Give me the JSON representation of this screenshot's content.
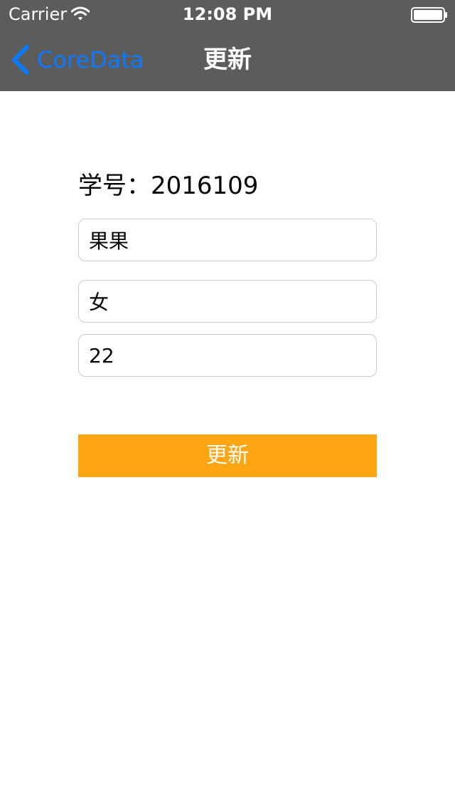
{
  "status_bar": {
    "carrier": "Carrier",
    "time": "12:08 PM",
    "wifi_icon": "wifi-icon",
    "battery_icon": "battery-icon"
  },
  "nav_bar": {
    "back_label": "CoreData",
    "back_icon": "chevron-left-icon",
    "title": "更新",
    "back_color": "#0a7bff",
    "background": "#5c5c5c"
  },
  "form": {
    "student_id_text": "学号：2016109",
    "name_value": "果果",
    "gender_value": "女",
    "age_value": "22",
    "submit_label": "更新",
    "submit_color": "#fda512"
  }
}
